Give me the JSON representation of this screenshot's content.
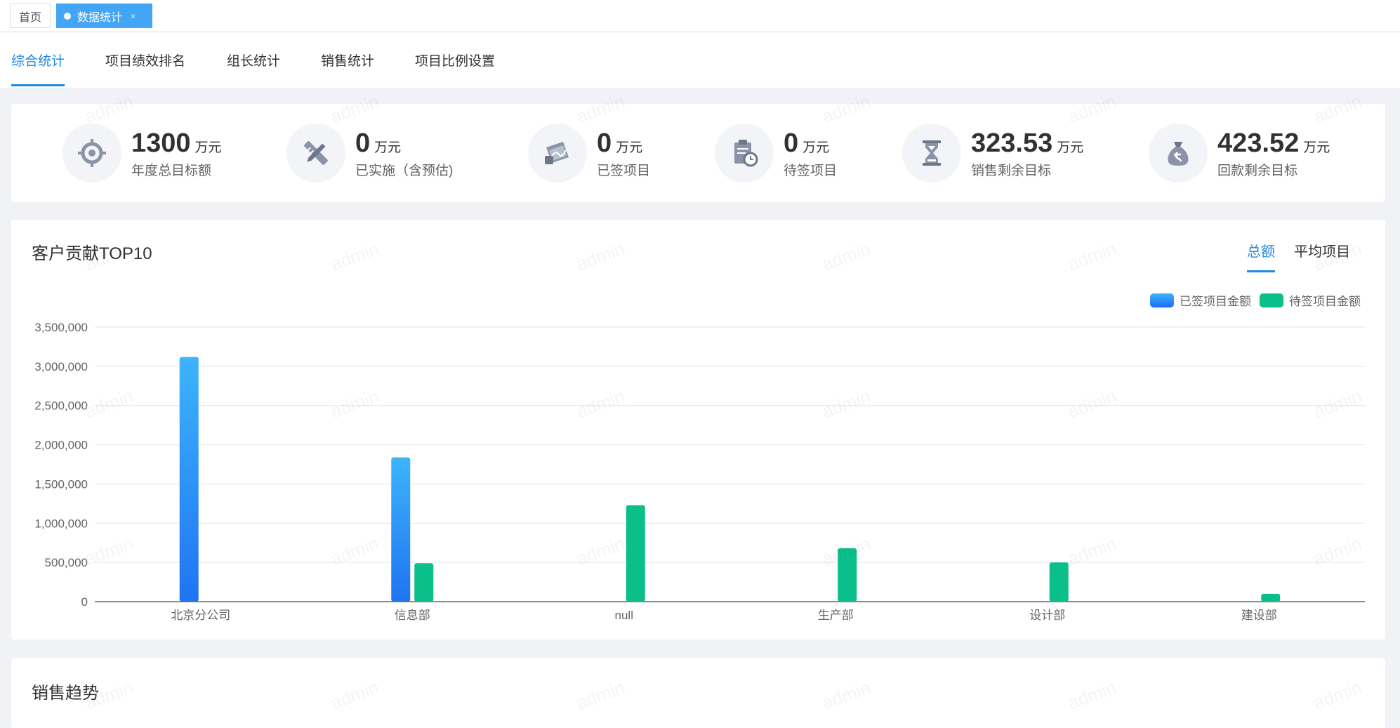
{
  "tags": {
    "home": "首页",
    "active": "数据统计",
    "close": "×"
  },
  "sub_tabs": [
    "综合统计",
    "项目绩效排名",
    "组长统计",
    "销售统计",
    "项目比例设置"
  ],
  "watermark": "admin",
  "stats": [
    {
      "value": "1300",
      "unit": "万元",
      "label": "年度总目标额",
      "icon": "target-icon"
    },
    {
      "value": "0",
      "unit": "万元",
      "label": "已实施（含预估)",
      "icon": "tools-icon"
    },
    {
      "value": "0",
      "unit": "万元",
      "label": "已签项目",
      "icon": "signed-document-icon"
    },
    {
      "value": "0",
      "unit": "万元",
      "label": "待签项目",
      "icon": "clipboard-clock-icon"
    },
    {
      "value": "323.53",
      "unit": "万元",
      "label": "销售剩余目标",
      "icon": "hourglass-icon"
    },
    {
      "value": "423.52",
      "unit": "万元",
      "label": "回款剩余目标",
      "icon": "money-bag-icon"
    }
  ],
  "chart_section": {
    "title": "客户贡献TOP10",
    "tabs": [
      "总额",
      "平均项目"
    ]
  },
  "chart_data": {
    "type": "bar",
    "categories": [
      "北京分公司",
      "信息部",
      "null",
      "生产部",
      "设计部",
      "建设部"
    ],
    "series": [
      {
        "name": "已签项目金额",
        "color": "#1e88e5",
        "values": [
          3120000,
          1840000,
          0,
          0,
          0,
          0
        ]
      },
      {
        "name": "待签项目金额",
        "color": "#0bbf8a",
        "values": [
          0,
          490000,
          1230000,
          680000,
          500000,
          100000
        ]
      }
    ],
    "ylim": [
      0,
      3500000
    ],
    "yticks": [
      "3,500,000",
      "3,000,000",
      "2,500,000",
      "2,000,000",
      "1,500,000",
      "1,000,000",
      "500,000",
      "0"
    ],
    "legend_position": "top-right",
    "grid": true
  },
  "trend_section": {
    "title": "销售趋势"
  }
}
